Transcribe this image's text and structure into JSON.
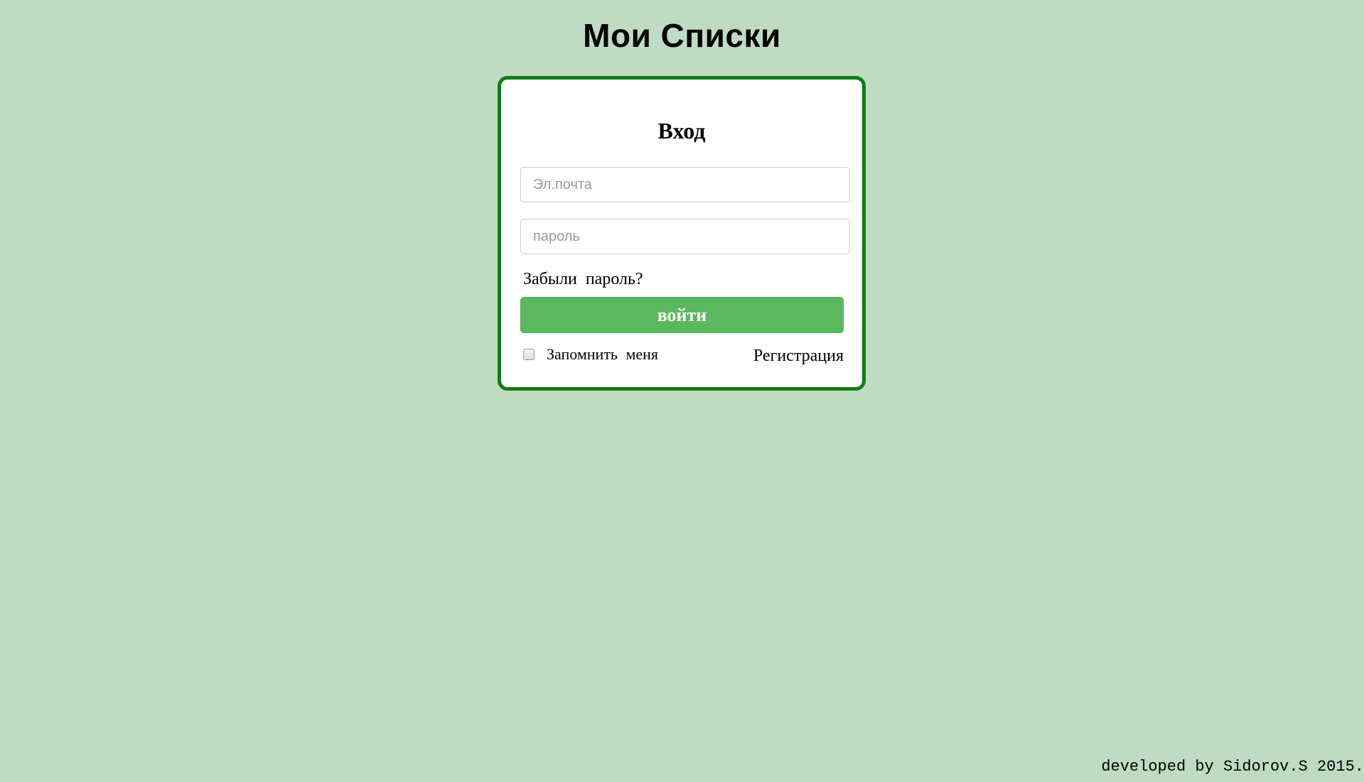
{
  "header": {
    "title": "Мои Списки"
  },
  "login_form": {
    "heading": "Вход",
    "email_placeholder": "Эл.почта",
    "password_placeholder": "пароль",
    "forgot_password": "Забыли пароль?",
    "submit_label": "войти",
    "remember_me_label": "Запомнить меня",
    "remember_me_checked": false,
    "register_link": "Регистрация"
  },
  "footer": {
    "credit": "developed by Sidorov.S 2015."
  },
  "colors": {
    "background": "#bfdbc3",
    "card_border": "#0f7d15",
    "button": "#5cb85f"
  }
}
